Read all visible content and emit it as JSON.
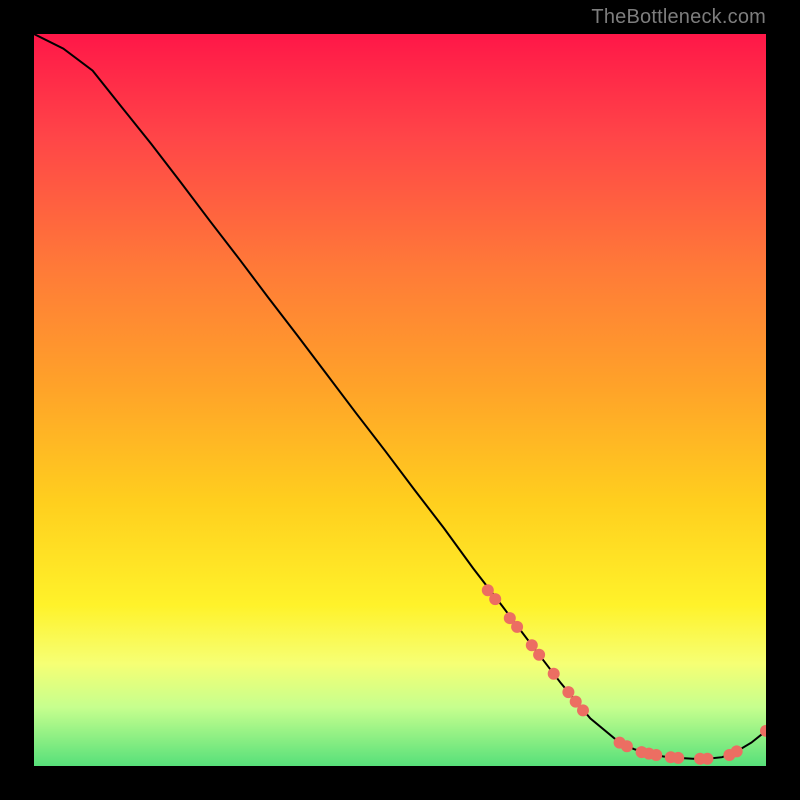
{
  "watermark": {
    "text": "TheBottleneck.com"
  },
  "chart_data": {
    "type": "line",
    "title": "",
    "xlabel": "",
    "ylabel": "",
    "xlim": [
      0,
      100
    ],
    "ylim": [
      0,
      100
    ],
    "grid": false,
    "series": [
      {
        "name": "curve",
        "x": [
          0,
          4,
          8,
          12,
          16,
          20,
          24,
          28,
          32,
          36,
          40,
          44,
          48,
          52,
          56,
          60,
          64,
          68,
          72,
          76,
          80,
          82,
          84,
          86,
          88,
          90,
          92,
          94,
          96,
          98,
          100
        ],
        "y": [
          100,
          98,
          95,
          90,
          85,
          79.8,
          74.5,
          69.3,
          64,
          58.8,
          53.5,
          48.2,
          43,
          37.7,
          32.5,
          27,
          21.8,
          16.5,
          11.3,
          6.5,
          3.2,
          2.3,
          1.7,
          1.3,
          1.1,
          1.0,
          1.0,
          1.2,
          2.0,
          3.2,
          4.8
        ],
        "color": "#000000"
      }
    ],
    "markers": [
      {
        "x": 62,
        "y": 24.0
      },
      {
        "x": 63,
        "y": 22.8
      },
      {
        "x": 65,
        "y": 20.2
      },
      {
        "x": 66,
        "y": 19.0
      },
      {
        "x": 68,
        "y": 16.5
      },
      {
        "x": 69,
        "y": 15.2
      },
      {
        "x": 71,
        "y": 12.6
      },
      {
        "x": 73,
        "y": 10.1
      },
      {
        "x": 74,
        "y": 8.8
      },
      {
        "x": 75,
        "y": 7.6
      },
      {
        "x": 80,
        "y": 3.2
      },
      {
        "x": 81,
        "y": 2.7
      },
      {
        "x": 83,
        "y": 1.9
      },
      {
        "x": 84,
        "y": 1.7
      },
      {
        "x": 85,
        "y": 1.5
      },
      {
        "x": 87,
        "y": 1.2
      },
      {
        "x": 88,
        "y": 1.1
      },
      {
        "x": 91,
        "y": 1.0
      },
      {
        "x": 92,
        "y": 1.0
      },
      {
        "x": 95,
        "y": 1.5
      },
      {
        "x": 96,
        "y": 2.0
      },
      {
        "x": 100,
        "y": 4.8
      }
    ],
    "marker_style": {
      "color": "#ec6e62",
      "radius_px": 6
    }
  }
}
